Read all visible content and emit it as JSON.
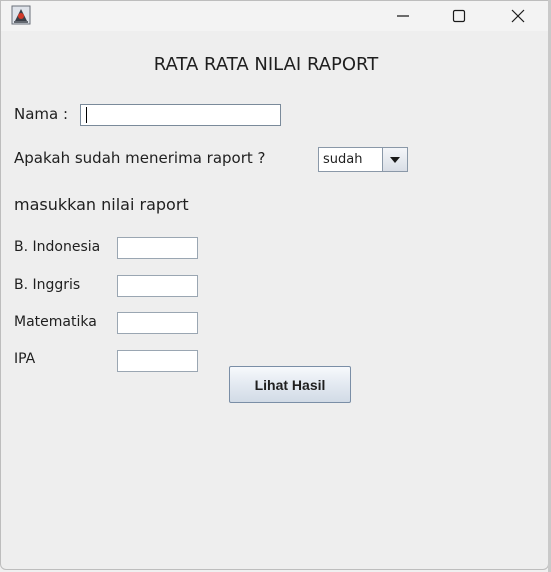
{
  "window": {
    "title_icon": "java-duke-icon",
    "controls": {
      "minimize": "minimize-icon",
      "maximize": "maximize-icon",
      "close": "close-icon"
    }
  },
  "form": {
    "title": "RATA RATA NILAI RAPORT",
    "nama_label": "Nama :",
    "nama_value": "",
    "question_label": "Apakah sudah menerima raport ?",
    "received_selected": "sudah",
    "section_label": "masukkan nilai raport",
    "subjects": [
      {
        "label": "B. Indonesia",
        "value": ""
      },
      {
        "label": "B. Inggris",
        "value": ""
      },
      {
        "label": "Matematika",
        "value": ""
      },
      {
        "label": "IPA",
        "value": ""
      }
    ],
    "submit_label": "Lihat Hasil"
  }
}
